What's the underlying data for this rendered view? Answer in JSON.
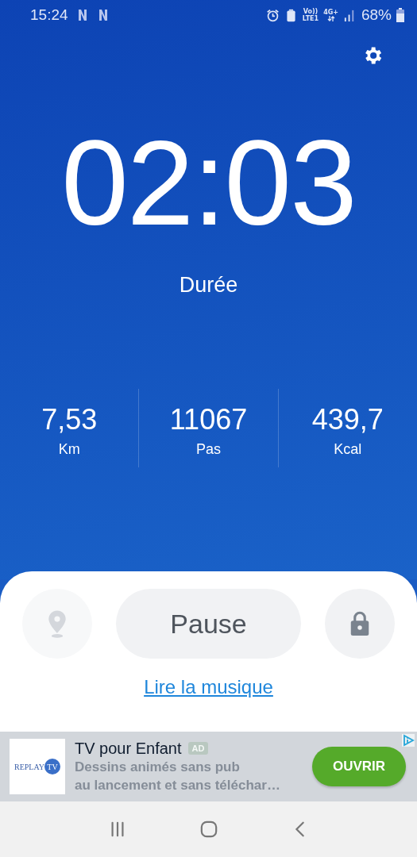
{
  "status_bar": {
    "time": "15:24",
    "volte": "Vo))",
    "lte": "LTE1",
    "network": "4G+",
    "battery": "68%"
  },
  "timer": {
    "value": "02:03",
    "label": "Durée"
  },
  "stats": [
    {
      "value": "7,53",
      "unit": "Km"
    },
    {
      "value": "11067",
      "unit": "Pas"
    },
    {
      "value": "439,7",
      "unit": "Kcal"
    }
  ],
  "controls": {
    "location_button": {
      "disabled": true
    },
    "pause_button": {
      "label": "Pause"
    },
    "lock_button": {
      "disabled": false
    },
    "music_link": "Lire la musique"
  },
  "ad": {
    "logo": [
      "REPLAY",
      "TV"
    ],
    "title": "TV pour Enfant",
    "badge": "AD",
    "description": [
      "Dessins animés sans pub",
      "au lancement et sans téléchar…"
    ],
    "button": "OUVRIR"
  }
}
